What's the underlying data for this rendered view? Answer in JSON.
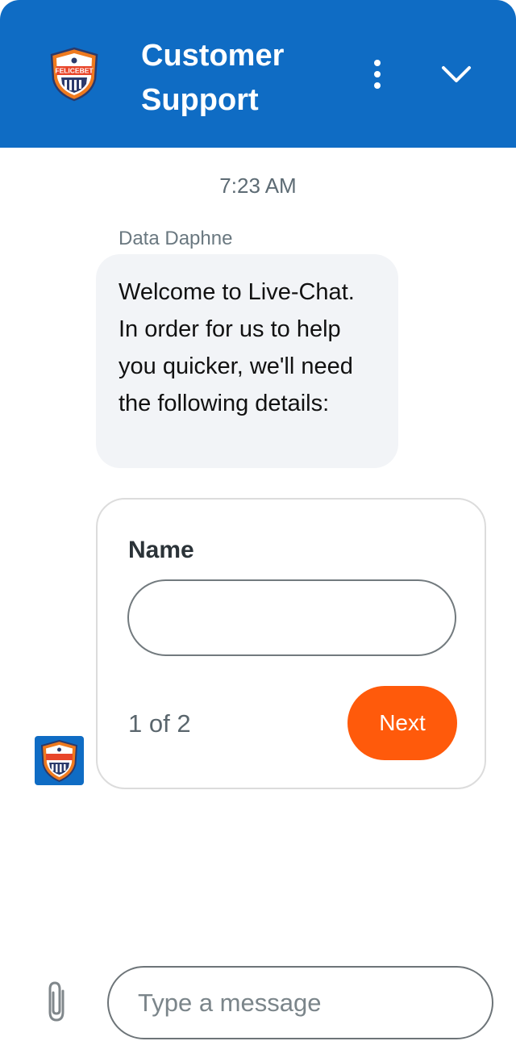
{
  "header": {
    "title": "Customer Support",
    "logo_icon": "felicebet-shield-logo",
    "logo_text": "FELICEBET",
    "menu_icon": "more-vertical-icon",
    "collapse_icon": "chevron-down-icon",
    "bg_color": "#0f6cc4"
  },
  "chat": {
    "timestamp": "7:23 AM",
    "sender": "Data Daphne",
    "message": "Welcome to Live-Chat. In order for us to help you quicker, we'll need the following details:",
    "avatar_icon": "felicebet-shield-logo"
  },
  "form": {
    "field_label": "Name",
    "field_value": "",
    "pager": "1 of 2",
    "next_label": "Next",
    "accent_color": "#ff5a0b"
  },
  "composer": {
    "placeholder": "Type a message",
    "attach_icon": "paperclip-icon"
  }
}
